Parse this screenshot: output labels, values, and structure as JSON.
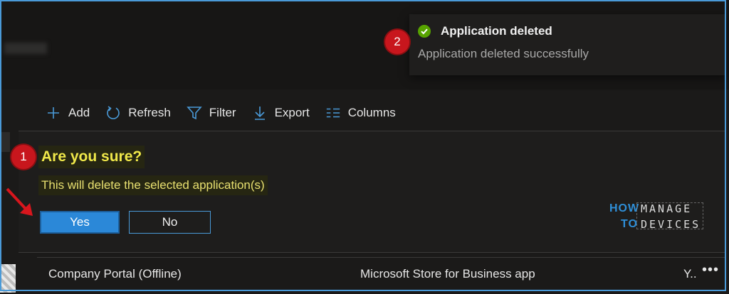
{
  "toast": {
    "title": "Application deleted",
    "message": "Application deleted successfully"
  },
  "annotations": {
    "step1": "1",
    "step2": "2"
  },
  "toolbar": {
    "add": "Add",
    "refresh": "Refresh",
    "filter": "Filter",
    "export": "Export",
    "columns": "Columns"
  },
  "dialog": {
    "title": "Are you sure?",
    "message": "This will delete the selected application(s)",
    "yes_label": "Yes",
    "no_label": "No"
  },
  "logo": {
    "how": "HOW",
    "to": "TO",
    "manage": "MANAGE",
    "devices": "DEVICES"
  },
  "table_row": {
    "name": "Company Portal (Offline)",
    "type": "Microsoft Store for Business app",
    "status": "Y..",
    "more": "•••"
  },
  "colors": {
    "accent": "#2b88d8",
    "success": "#57a300",
    "highlight_text": "#f0e84a",
    "badge": "#c8161d"
  }
}
